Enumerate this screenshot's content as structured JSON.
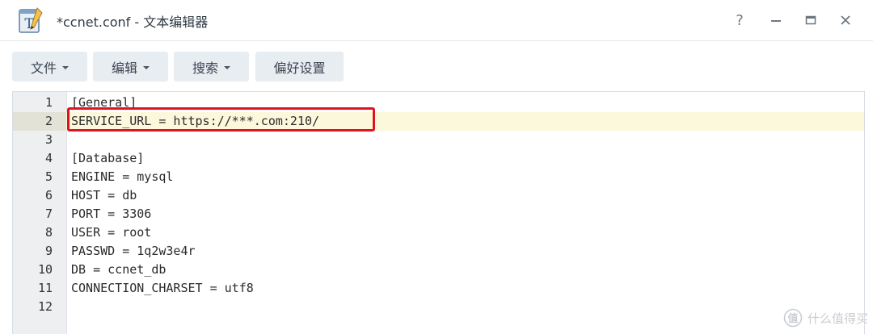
{
  "window": {
    "title": "*ccnet.conf - 文本编辑器",
    "app_icon": "text-editor-icon",
    "controls": {
      "help": "?",
      "minimize": "minimize-icon",
      "maximize": "maximize-icon",
      "close": "close-icon"
    }
  },
  "toolbar": {
    "file_label": "文件",
    "edit_label": "编辑",
    "search_label": "搜索",
    "prefs_label": "偏好设置"
  },
  "editor": {
    "active_line": 2,
    "lines": [
      {
        "num": "1",
        "text": "[General]"
      },
      {
        "num": "2",
        "text": "SERVICE_URL = https://***.com:210/"
      },
      {
        "num": "3",
        "text": ""
      },
      {
        "num": "4",
        "text": "[Database]"
      },
      {
        "num": "5",
        "text": "ENGINE = mysql"
      },
      {
        "num": "6",
        "text": "HOST = db"
      },
      {
        "num": "7",
        "text": "PORT = 3306"
      },
      {
        "num": "8",
        "text": "USER = root"
      },
      {
        "num": "9",
        "text": "PASSWD = 1q2w3e4r"
      },
      {
        "num": "10",
        "text": "DB = ccnet_db"
      },
      {
        "num": "11",
        "text": "CONNECTION_CHARSET = utf8"
      },
      {
        "num": "12",
        "text": ""
      }
    ],
    "highlight_color": "#e2131e",
    "active_line_bg": "#fcf8dc"
  },
  "watermark": {
    "text": "什么值得买",
    "logo": "smzdm-logo-icon"
  }
}
